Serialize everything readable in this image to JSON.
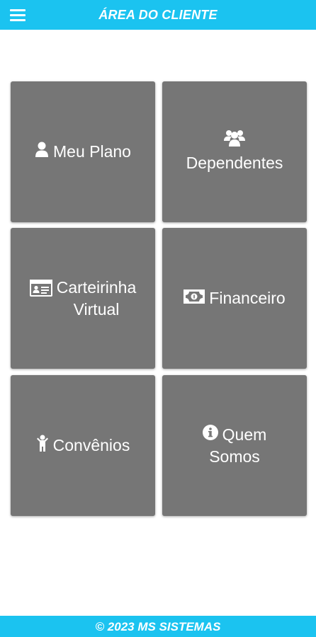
{
  "header": {
    "title": "ÁREA DO CLIENTE",
    "menu_icon": "hamburger-menu-icon"
  },
  "tiles": [
    {
      "label": "Meu Plano",
      "icon": "user-icon"
    },
    {
      "label": "Dependentes",
      "icon": "users-group-icon"
    },
    {
      "label_line1": "Carteirinha",
      "label_line2": "Virtual",
      "icon": "id-card-icon"
    },
    {
      "label": "Financeiro",
      "icon": "money-bill-icon"
    },
    {
      "label": "Convênios",
      "icon": "child-icon"
    },
    {
      "label_line1": "Quem",
      "label_line2": "Somos",
      "icon": "info-circle-icon"
    }
  ],
  "footer": {
    "text": "©  2023  MS SISTEMAS"
  },
  "colors": {
    "accent": "#1bc3f0",
    "tile": "#767676",
    "text": "#ffffff"
  }
}
